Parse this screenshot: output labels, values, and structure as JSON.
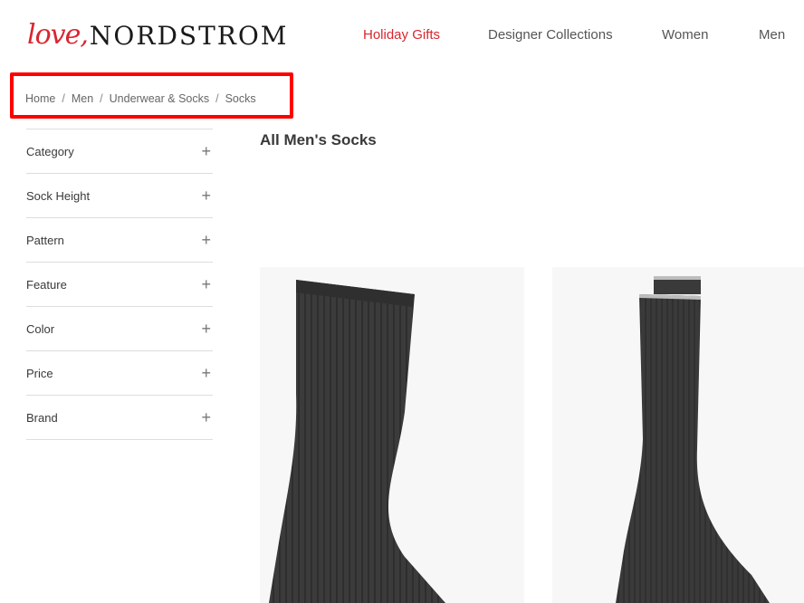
{
  "header": {
    "logo_script": "love,",
    "logo_word": "NORDSTROM",
    "nav": [
      {
        "label": "Holiday Gifts",
        "active": true
      },
      {
        "label": "Designer Collections",
        "active": false
      },
      {
        "label": "Women",
        "active": false
      },
      {
        "label": "Men",
        "active": false
      }
    ]
  },
  "breadcrumb": [
    "Home",
    "Men",
    "Underwear & Socks",
    "Socks"
  ],
  "breadcrumb_separator": "/",
  "sidebar": {
    "facets": [
      "Category",
      "Sock Height",
      "Pattern",
      "Feature",
      "Color",
      "Price",
      "Brand"
    ],
    "expand_icon": "plus-icon"
  },
  "main": {
    "title": "All Men's Socks"
  },
  "colors": {
    "brand_red": "#d9262f",
    "highlight_box": "#ff0000",
    "text": "#393939",
    "sock": "#3a3a3a"
  }
}
